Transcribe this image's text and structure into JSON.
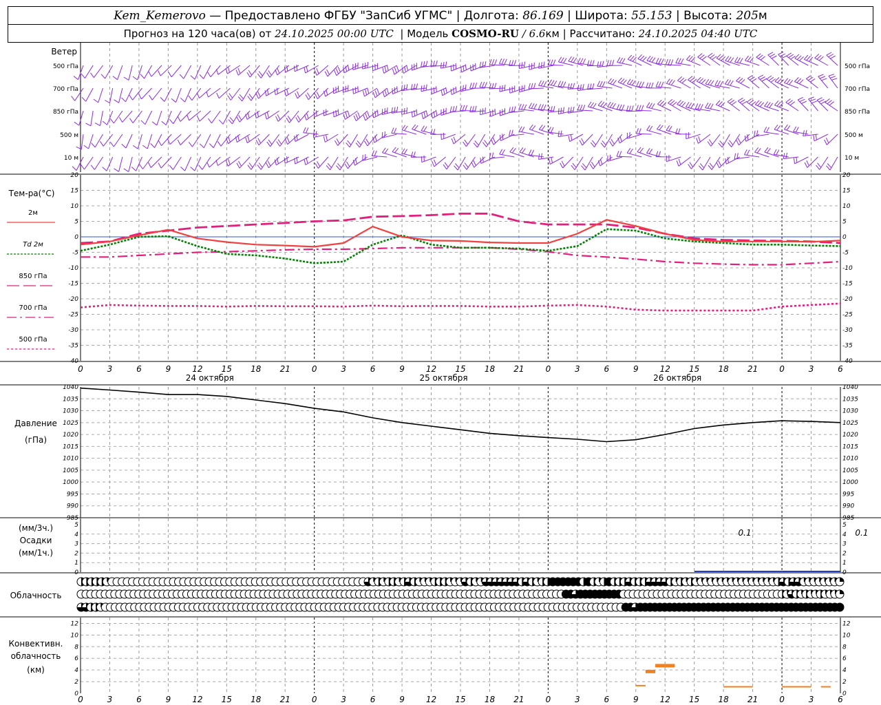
{
  "header": {
    "station": "Kem_Kemerovo",
    "provider": "— Предоставлено ФГБУ \"ЗапСиб УГМС\"",
    "lon_label": "Долгота:",
    "lon": "86.169",
    "lat_label": "Широта:",
    "lat": "55.153",
    "alt_label": "Высота:",
    "alt": "205",
    "alt_unit": "м",
    "forecast_prefix": "Прогноз на 120 часа(ов) от",
    "forecast_start": "24.10.2025 00:00 UTC",
    "model_label": "Модель",
    "model": "COSMO-RU",
    "resolution": "/ 6.6",
    "resolution_unit": "км",
    "computed_label": "Рассчитано:",
    "computed": "24.10.2025 04:40 UTC"
  },
  "colors": {
    "wind": "#8a2be2",
    "t2m": "#f04040",
    "td2m": "#008000",
    "t850": "#e0207a",
    "t700": "#e0207a",
    "t500": "#e0207a",
    "zero": "#3050d0",
    "pressure": "#000000",
    "precip": "#2040c0",
    "conv": "#f08020"
  },
  "time_axis": {
    "hour_labels": [
      "0",
      "3",
      "6",
      "9",
      "12",
      "15",
      "18",
      "21",
      "0",
      "3",
      "6",
      "9",
      "12",
      "15",
      "18",
      "21",
      "0",
      "3",
      "6",
      "9",
      "12",
      "15",
      "18",
      "21",
      "0",
      "3",
      "6"
    ],
    "day_labels": [
      "24 октября",
      "25 октября",
      "26 октября"
    ]
  },
  "wind_panel": {
    "title": "Ветер",
    "levels": [
      "500 гПа",
      "700 гПа",
      "850 гПа",
      "500 м",
      "10 м"
    ]
  },
  "temp_panel": {
    "title": "Тем-ра(°C)",
    "legend": [
      "2м",
      "Td  2м",
      "850 гПа",
      "700 гПа",
      "500 гПа"
    ],
    "yticks": [
      "20",
      "15",
      "10",
      "5",
      "0",
      "-5",
      "-10",
      "-15",
      "-20",
      "-25",
      "-30",
      "-35",
      "-40"
    ]
  },
  "pressure_panel": {
    "title": "Давление",
    "unit": "(гПа)",
    "yticks": [
      "1040",
      "1035",
      "1030",
      "1025",
      "1020",
      "1015",
      "1010",
      "1005",
      "1000",
      "995",
      "990",
      "985"
    ]
  },
  "precip_panel": {
    "unit_top": "(мм/3ч.)",
    "title": "Осадки",
    "unit_bottom": "(мм/1ч.)",
    "yticks": [
      "5",
      "4",
      "3",
      "2",
      "1",
      "0"
    ],
    "labels": [
      "0.1",
      "0.1",
      "0.1",
      "0.1"
    ]
  },
  "cloud_panel": {
    "title": "Облачность"
  },
  "conv_panel": {
    "title_l1": "Конвективн.",
    "title_l2": "облачность",
    "unit": "(км)",
    "yticks": [
      "12",
      "10",
      "8",
      "6",
      "4",
      "2",
      "0"
    ]
  },
  "chart_data": {
    "type": "line",
    "x_unit": "hours since 24.10.2025 00:00 UTC",
    "x_range": [
      0,
      78
    ],
    "series": [
      {
        "name": "2м",
        "x": [
          0,
          3,
          6,
          9,
          12,
          15,
          18,
          21,
          24,
          27,
          30,
          33,
          36,
          39,
          42,
          45,
          48,
          51,
          54,
          57,
          60,
          63,
          66,
          69,
          72,
          75,
          78
        ],
        "values": [
          -2.5,
          -1.5,
          0.5,
          2.3,
          -0.5,
          -1.7,
          -2.5,
          -2.8,
          -3.2,
          -2,
          3.3,
          0,
          -1.2,
          -1.3,
          -1.8,
          -2,
          -2,
          1,
          5.5,
          3.5,
          1,
          -1,
          -1.5,
          -1.5,
          -1.5,
          -1.6,
          -1.2
        ]
      },
      {
        "name": "Td  2м",
        "x": [
          0,
          3,
          6,
          9,
          12,
          15,
          18,
          21,
          24,
          27,
          30,
          33,
          36,
          39,
          42,
          45,
          48,
          51,
          54,
          57,
          60,
          63,
          66,
          69,
          72,
          75,
          78
        ],
        "values": [
          -4.5,
          -2.5,
          0,
          0.2,
          -3,
          -5.5,
          -6,
          -7,
          -8.5,
          -8,
          -2.5,
          0.5,
          -2.5,
          -3.5,
          -3.5,
          -3.8,
          -4.5,
          -3,
          2.5,
          2,
          -0.5,
          -1.5,
          -2,
          -2.5,
          -2.5,
          -2.8,
          -3
        ]
      },
      {
        "name": "850 гПа",
        "x": [
          0,
          3,
          6,
          9,
          12,
          15,
          18,
          21,
          24,
          27,
          30,
          33,
          36,
          39,
          42,
          45,
          48,
          51,
          54,
          57,
          60,
          63,
          66,
          69,
          72,
          75,
          78
        ],
        "values": [
          -2,
          -1.5,
          1,
          2,
          3,
          3.5,
          4,
          4.5,
          5,
          5.3,
          6.5,
          6.7,
          7,
          7.5,
          7.5,
          5,
          4,
          4,
          4,
          3,
          1,
          -0.5,
          -1,
          -1.2,
          -1.3,
          -1.5,
          -2
        ]
      },
      {
        "name": "700 гПа",
        "x": [
          0,
          3,
          6,
          9,
          12,
          15,
          18,
          21,
          24,
          27,
          30,
          33,
          36,
          39,
          42,
          45,
          48,
          51,
          54,
          57,
          60,
          63,
          66,
          69,
          72,
          75,
          78
        ],
        "values": [
          -6.5,
          -6.5,
          -6,
          -5.5,
          -5,
          -4.8,
          -4.5,
          -4.2,
          -4,
          -4,
          -3.8,
          -3.5,
          -3.5,
          -3.5,
          -3.5,
          -4,
          -4.8,
          -6,
          -6.5,
          -7.2,
          -8,
          -8.5,
          -8.8,
          -9,
          -9,
          -8.5,
          -8
        ]
      },
      {
        "name": "500 гПа",
        "x": [
          0,
          3,
          6,
          9,
          12,
          15,
          18,
          21,
          24,
          27,
          30,
          33,
          36,
          39,
          42,
          45,
          48,
          51,
          54,
          57,
          60,
          63,
          66,
          69,
          72,
          75,
          78
        ],
        "values": [
          -22.8,
          -22,
          -22.2,
          -22.3,
          -22.3,
          -22.5,
          -22.3,
          -22.4,
          -22.4,
          -22.5,
          -22.2,
          -22.4,
          -22.3,
          -22.3,
          -22.5,
          -22.5,
          -22.2,
          -22,
          -22.5,
          -23.5,
          -23.8,
          -23.8,
          -23.8,
          -23.8,
          -22.5,
          -22,
          -21.5
        ]
      },
      {
        "name": "Давление",
        "x": [
          0,
          3,
          6,
          9,
          12,
          15,
          18,
          21,
          24,
          27,
          30,
          33,
          36,
          39,
          42,
          45,
          48,
          51,
          54,
          57,
          60,
          63,
          66,
          69,
          72,
          75,
          78
        ],
        "values": [
          1039.5,
          1038.7,
          1037.8,
          1036.8,
          1036.8,
          1036,
          1034.5,
          1033,
          1031,
          1029.5,
          1027,
          1025,
          1023.5,
          1022,
          1020.5,
          1019.5,
          1018.7,
          1018,
          1017,
          1017.8,
          1020,
          1022.5,
          1024,
          1025,
          1025.8,
          1025.5,
          1025
        ]
      }
    ],
    "precip_mm": {
      "x": [
        54,
        57,
        60,
        63,
        66,
        69,
        72,
        75,
        78
      ],
      "values": [
        0,
        0,
        0,
        0,
        0.1,
        0.1,
        0.1,
        0.1,
        0.1
      ]
    },
    "convective_cloud_km": [
      {
        "x_start": 57,
        "x_end": 58,
        "top": 1.2
      },
      {
        "x_start": 58,
        "x_end": 59,
        "top": 3.8
      },
      {
        "x_start": 59,
        "x_end": 60,
        "top": 4.8
      },
      {
        "x_start": 60,
        "x_end": 61,
        "top": 4.8
      },
      {
        "x_start": 66,
        "x_end": 69,
        "top": 1
      },
      {
        "x_start": 72,
        "x_end": 75,
        "top": 1
      },
      {
        "x_start": 76,
        "x_end": 77,
        "top": 1
      }
    ],
    "cloud_cover_rows": [
      "upper",
      "middle",
      "lower"
    ],
    "cloud_cover": {
      "upper": [
        0.5,
        0.5,
        0.5,
        0.5,
        0.5,
        0.25,
        0,
        0,
        0,
        0,
        0,
        0,
        0,
        0,
        0,
        0,
        0,
        0,
        0,
        0,
        0,
        0,
        0,
        0,
        0,
        0,
        0,
        0,
        0,
        0,
        0,
        0,
        0,
        0,
        0,
        0,
        0,
        0,
        0,
        0,
        0,
        0,
        0,
        0,
        0,
        0,
        0,
        0,
        0,
        0,
        0,
        0,
        0,
        0,
        0,
        0,
        0.75,
        0.25,
        0.5,
        0.25,
        0.5,
        0.5,
        0.25,
        0.5,
        0.75,
        0.5,
        0.25,
        0.25,
        0.25,
        0.5,
        0.5,
        0.5,
        0.25,
        0.25,
        0.25,
        0.75,
        0.5,
        0.25,
        0.25,
        0.75,
        0.75,
        0.75,
        0.75,
        0.75,
        0.75,
        0.75,
        0.5,
        0.75,
        0.5,
        0.25,
        0.5,
        0.5,
        1,
        1,
        1,
        1,
        1,
        1,
        0.5,
        1,
        0.5,
        0.25,
        0.5,
        1,
        0.5,
        0.5,
        0.5,
        0.75,
        0.5,
        0.5,
        0.5,
        0.75,
        0.75,
        0.75,
        0.75,
        0.5,
        0.25,
        0.5,
        0.25,
        0.5,
        0.25,
        0.25,
        0.25,
        0.25,
        0.25,
        0.25,
        0.25,
        0.25,
        0.25,
        0.25,
        0.25,
        0.25,
        0.25,
        0.25,
        0.25,
        0.25,
        0.5,
        0.75,
        0.5,
        0.75,
        0.75,
        0.25,
        0.25,
        0.25,
        0.25,
        0.25,
        0.25,
        0.25,
        0.25
      ],
      "middle": [
        0,
        0,
        0,
        0,
        0,
        0,
        0,
        0,
        0,
        0,
        0,
        0,
        0,
        0,
        0,
        0,
        0,
        0,
        0,
        0,
        0,
        0,
        0,
        0,
        0,
        0,
        0,
        0,
        0,
        0,
        0,
        0,
        0,
        0,
        0,
        0,
        0,
        0,
        0,
        0,
        0,
        0,
        0,
        0,
        0,
        0,
        0,
        0,
        0,
        0,
        0,
        0,
        0,
        0,
        0,
        0,
        0,
        0,
        0,
        0,
        0,
        0,
        0,
        0,
        0,
        0,
        0,
        0,
        0,
        0,
        0,
        0,
        0,
        0,
        0,
        0,
        0,
        0,
        0,
        0,
        0,
        0,
        0,
        0,
        0,
        0,
        0,
        0,
        0,
        0,
        0,
        0,
        0,
        0,
        0,
        0,
        0,
        0,
        0,
        0,
        0,
        1,
        1,
        0.75,
        1,
        1,
        1,
        1,
        1,
        1,
        1,
        1,
        1,
        0,
        0,
        0,
        0,
        0,
        0,
        0,
        0,
        0,
        0,
        0,
        0,
        0,
        0,
        0,
        0,
        0,
        0,
        0,
        0,
        0,
        0,
        0,
        0,
        0,
        0,
        0,
        0,
        0,
        0,
        0,
        0,
        0,
        0.5,
        0.25,
        0.75,
        0.5,
        0.25,
        0.5,
        0.25,
        0.25,
        0.5,
        0.25,
        0.25,
        0.25,
        0.25
      ],
      "lower": [
        0.75,
        0.75,
        0.5,
        0.5,
        0.25,
        0,
        0,
        0,
        0,
        0,
        0,
        0,
        0,
        0,
        0,
        0,
        0,
        0,
        0,
        0,
        0,
        0,
        0,
        0,
        0,
        0,
        0,
        0,
        0,
        0,
        0,
        0,
        0,
        0,
        0,
        0,
        0,
        0,
        0,
        0,
        0,
        0,
        0,
        0,
        0,
        0,
        0,
        0,
        0,
        0,
        0,
        0,
        0,
        0,
        0,
        0,
        0,
        0,
        0,
        0,
        0,
        0,
        0,
        0,
        0,
        0,
        0,
        0,
        0,
        0,
        0,
        0,
        0,
        0,
        0,
        0,
        0,
        0,
        0,
        0,
        0,
        0,
        0,
        0,
        0,
        0,
        0,
        0,
        0,
        0,
        0,
        0,
        0,
        0,
        0,
        0,
        0,
        0,
        0,
        0,
        0,
        0,
        0,
        0,
        0,
        0,
        0,
        0,
        0,
        0,
        0,
        0,
        1,
        1,
        0.75,
        1,
        1,
        1,
        1,
        1,
        1,
        1,
        1,
        1,
        1,
        1,
        1,
        1,
        1,
        1,
        1,
        1,
        1,
        1,
        1,
        1,
        1,
        1,
        1,
        1,
        1,
        1,
        1,
        1,
        1,
        1,
        1,
        1,
        1,
        1,
        1,
        1,
        1,
        1,
        1,
        1,
        1
      ]
    },
    "ylim_temp": [
      -40,
      20
    ],
    "ylim_pressure": [
      985,
      1040
    ],
    "ylim_precip": [
      0,
      5
    ],
    "ylim_conv": [
      0,
      13
    ]
  }
}
